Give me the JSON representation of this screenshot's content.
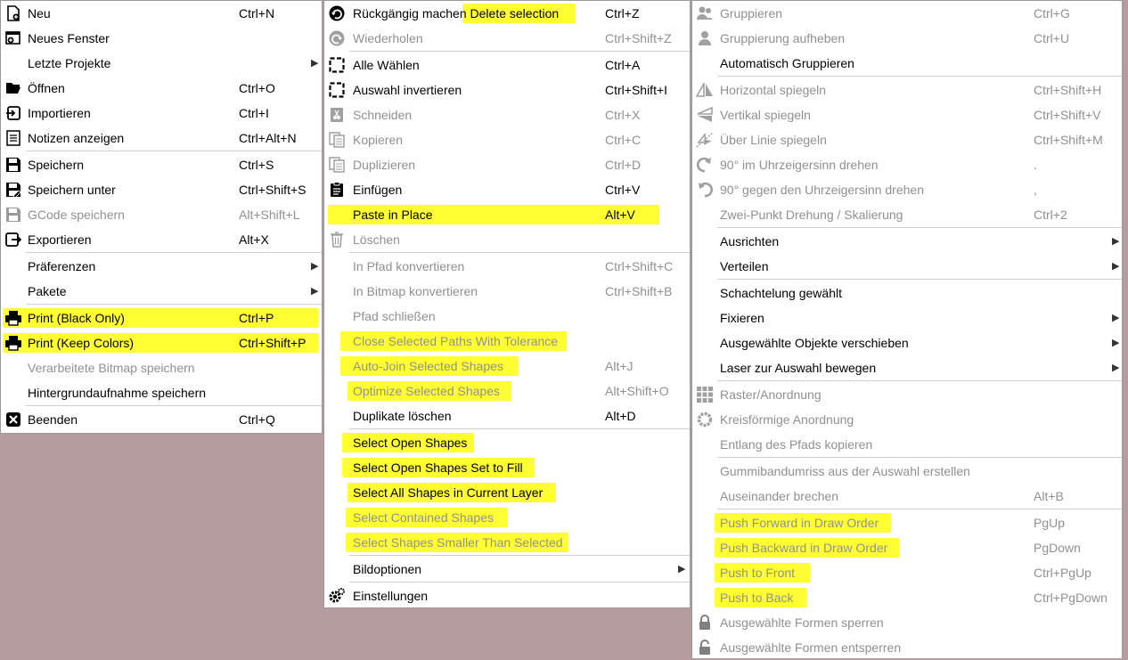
{
  "colors": {
    "highlight": "#ffff33",
    "disabled_text": "#909090",
    "desktop": "#b59d9f"
  },
  "file_menu": {
    "items": [
      {
        "name": "new",
        "label": "Neu",
        "shortcut": "Ctrl+N",
        "icon": "new-file-icon"
      },
      {
        "name": "new-window",
        "label": "Neues Fenster",
        "shortcut": "",
        "icon": "new-window-icon"
      },
      {
        "name": "recent-projects",
        "label": "Letzte Projekte",
        "shortcut": "",
        "submenu": true
      },
      {
        "name": "open",
        "label": "Öffnen",
        "shortcut": "Ctrl+O",
        "icon": "folder-open-icon"
      },
      {
        "name": "import",
        "label": "Importieren",
        "shortcut": "Ctrl+I",
        "icon": "import-icon"
      },
      {
        "name": "show-notes",
        "label": "Notizen anzeigen",
        "shortcut": "Ctrl+Alt+N",
        "icon": "notes-icon"
      },
      {
        "name": "save",
        "label": "Speichern",
        "shortcut": "Ctrl+S",
        "icon": "save-icon"
      },
      {
        "name": "save-as",
        "label": "Speichern unter",
        "shortcut": "Ctrl+Shift+S",
        "icon": "save-as-icon"
      },
      {
        "name": "save-gcode",
        "label": "GCode speichern",
        "shortcut": "Alt+Shift+L",
        "icon": "save-gcode-icon",
        "disabled": true
      },
      {
        "name": "export",
        "label": "Exportieren",
        "shortcut": "Alt+X",
        "icon": "export-icon"
      },
      {
        "name": "preferences",
        "label": "Präferenzen",
        "shortcut": "",
        "submenu": true
      },
      {
        "name": "packages",
        "label": "Pakete",
        "shortcut": "",
        "submenu": true
      },
      {
        "name": "print-black",
        "label": "Print (Black Only)",
        "shortcut": "Ctrl+P",
        "icon": "printer-icon",
        "highlight": true
      },
      {
        "name": "print-colors",
        "label": "Print (Keep Colors)",
        "shortcut": "Ctrl+Shift+P",
        "icon": "printer-icon",
        "highlight": true
      },
      {
        "name": "save-processed-bitmap",
        "label": "Verarbeitete Bitmap speichern",
        "shortcut": "",
        "disabled": true
      },
      {
        "name": "save-background-capture",
        "label": "Hintergrundaufnahme speichern",
        "shortcut": ""
      },
      {
        "name": "exit",
        "label": "Beenden",
        "shortcut": "Ctrl+Q",
        "icon": "close-icon"
      }
    ]
  },
  "edit_menu": {
    "items": [
      {
        "name": "undo",
        "label": "Rückgängig machen Delete selection",
        "shortcut": "Ctrl+Z",
        "icon": "undo-icon"
      },
      {
        "name": "redo",
        "label": "Wiederholen",
        "shortcut": "Ctrl+Shift+Z",
        "icon": "redo-icon",
        "disabled": true
      },
      {
        "name": "select-all",
        "label": "Alle Wählen",
        "shortcut": "Ctrl+A",
        "icon": "select-all-icon"
      },
      {
        "name": "invert-selection",
        "label": "Auswahl invertieren",
        "shortcut": "Ctrl+Shift+I",
        "icon": "invert-selection-icon"
      },
      {
        "name": "cut",
        "label": "Schneiden",
        "shortcut": "Ctrl+X",
        "icon": "cut-icon",
        "disabled": true
      },
      {
        "name": "copy",
        "label": "Kopieren",
        "shortcut": "Ctrl+C",
        "icon": "copy-icon",
        "disabled": true
      },
      {
        "name": "duplicate",
        "label": "Duplizieren",
        "shortcut": "Ctrl+D",
        "icon": "duplicate-icon",
        "disabled": true
      },
      {
        "name": "paste",
        "label": "Einfügen",
        "shortcut": "Ctrl+V",
        "icon": "paste-icon"
      },
      {
        "name": "paste-in-place",
        "label": "Paste in Place",
        "shortcut": "Alt+V",
        "highlight": true
      },
      {
        "name": "delete",
        "label": "Löschen",
        "shortcut": "",
        "icon": "trash-icon",
        "disabled": true
      },
      {
        "name": "convert-to-path",
        "label": "In Pfad konvertieren",
        "shortcut": "Ctrl+Shift+C",
        "disabled": true
      },
      {
        "name": "convert-to-bitmap",
        "label": "In Bitmap konvertieren",
        "shortcut": "Ctrl+Shift+B",
        "disabled": true
      },
      {
        "name": "close-path",
        "label": "Pfad schließen",
        "shortcut": "",
        "disabled": true
      },
      {
        "name": "close-paths-tolerance",
        "label": "Close Selected Paths With Tolerance",
        "shortcut": "",
        "disabled": true,
        "highlight": true
      },
      {
        "name": "auto-join",
        "label": "Auto-Join Selected Shapes",
        "shortcut": "Alt+J",
        "disabled": true,
        "highlight": true
      },
      {
        "name": "optimize-shapes",
        "label": "Optimize Selected Shapes",
        "shortcut": "Alt+Shift+O",
        "disabled": true,
        "highlight": true
      },
      {
        "name": "delete-duplicates",
        "label": "Duplikate löschen",
        "shortcut": "Alt+D"
      },
      {
        "name": "select-open-shapes",
        "label": "Select Open Shapes",
        "shortcut": "",
        "highlight": true
      },
      {
        "name": "select-open-shapes-fill",
        "label": "Select Open Shapes Set to Fill",
        "shortcut": "",
        "highlight": true
      },
      {
        "name": "select-all-layer",
        "label": "Select All Shapes in Current Layer",
        "shortcut": "",
        "highlight": true
      },
      {
        "name": "select-contained",
        "label": "Select Contained Shapes",
        "shortcut": "",
        "disabled": true,
        "highlight": true
      },
      {
        "name": "select-smaller",
        "label": "Select Shapes Smaller Than Selected",
        "shortcut": "",
        "disabled": true,
        "highlight": true
      },
      {
        "name": "image-options",
        "label": "Bildoptionen",
        "shortcut": "",
        "submenu": true
      },
      {
        "name": "settings",
        "label": "Einstellungen",
        "shortcut": "",
        "icon": "gear-icon"
      }
    ]
  },
  "arrange_menu": {
    "items": [
      {
        "name": "group",
        "label": "Gruppieren",
        "shortcut": "Ctrl+G",
        "icon": "group-icon",
        "disabled": true
      },
      {
        "name": "ungroup",
        "label": "Gruppierung aufheben",
        "shortcut": "Ctrl+U",
        "icon": "ungroup-icon",
        "disabled": true
      },
      {
        "name": "auto-group",
        "label": "Automatisch Gruppieren",
        "shortcut": ""
      },
      {
        "name": "flip-horizontal",
        "label": "Horizontal spiegeln",
        "shortcut": "Ctrl+Shift+H",
        "icon": "flip-horizontal-icon",
        "disabled": true
      },
      {
        "name": "flip-vertical",
        "label": "Vertikal spiegeln",
        "shortcut": "Ctrl+Shift+V",
        "icon": "flip-vertical-icon",
        "disabled": true
      },
      {
        "name": "mirror-line",
        "label": "Über Linie spiegeln",
        "shortcut": "Ctrl+Shift+M",
        "icon": "mirror-line-icon",
        "disabled": true
      },
      {
        "name": "rotate-cw",
        "label": "90° im Uhrzeigersinn drehen",
        "shortcut": ".",
        "icon": "rotate-cw-icon",
        "disabled": true
      },
      {
        "name": "rotate-ccw",
        "label": "90° gegen den Uhrzeigersinn drehen",
        "shortcut": ",",
        "icon": "rotate-ccw-icon",
        "disabled": true
      },
      {
        "name": "two-point-rotate",
        "label": "Zwei-Punkt Drehung / Skalierung",
        "shortcut": "Ctrl+2",
        "disabled": true
      },
      {
        "name": "align",
        "label": "Ausrichten",
        "shortcut": "",
        "submenu": true
      },
      {
        "name": "distribute",
        "label": "Verteilen",
        "shortcut": "",
        "submenu": true
      },
      {
        "name": "nest-selected",
        "label": "Schachtelung gewählt",
        "shortcut": ""
      },
      {
        "name": "lock",
        "label": "Fixieren",
        "shortcut": "",
        "submenu": true
      },
      {
        "name": "move-selected",
        "label": "Ausgewählte Objekte verschieben",
        "shortcut": "",
        "submenu": true
      },
      {
        "name": "move-laser",
        "label": "Laser zur Auswahl bewegen",
        "shortcut": "",
        "submenu": true
      },
      {
        "name": "grid-array",
        "label": "Raster/Anordnung",
        "shortcut": "",
        "icon": "grid-icon",
        "disabled": true
      },
      {
        "name": "circular-array",
        "label": "Kreisförmige Anordnung",
        "shortcut": "",
        "icon": "circular-array-icon",
        "disabled": true
      },
      {
        "name": "copy-along-path",
        "label": "Entlang des Pfads kopieren",
        "shortcut": "",
        "disabled": true
      },
      {
        "name": "rubber-band",
        "label": "Gummibandumriss aus der Auswahl erstellen",
        "shortcut": "",
        "disabled": true
      },
      {
        "name": "break-apart",
        "label": "Auseinander brechen",
        "shortcut": "Alt+B",
        "disabled": true
      },
      {
        "name": "push-forward",
        "label": "Push Forward in Draw Order",
        "shortcut": "PgUp",
        "disabled": true,
        "highlight": true
      },
      {
        "name": "push-backward",
        "label": "Push Backward in Draw Order",
        "shortcut": "PgDown",
        "disabled": true,
        "highlight": true
      },
      {
        "name": "push-front",
        "label": "Push to Front",
        "shortcut": "Ctrl+PgUp",
        "disabled": true,
        "highlight": true
      },
      {
        "name": "push-back",
        "label": "Push to Back",
        "shortcut": "Ctrl+PgDown",
        "disabled": true,
        "highlight": true
      },
      {
        "name": "lock-shapes",
        "label": "Ausgewählte Formen sperren",
        "shortcut": "",
        "icon": "lock-icon",
        "disabled": true
      },
      {
        "name": "unlock-shapes",
        "label": "Ausgewählte Formen entsperren",
        "shortcut": "",
        "icon": "unlock-icon",
        "disabled": true
      }
    ]
  }
}
